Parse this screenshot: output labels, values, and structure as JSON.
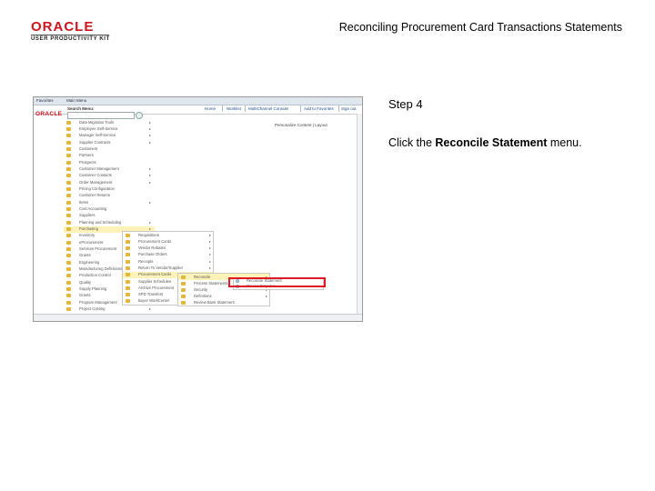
{
  "header": {
    "logo_text": "ORACLE",
    "logo_sub": "USER PRODUCTIVITY KIT",
    "doc_title": "Reconciling Procurement Card Transactions Statements"
  },
  "screenshot": {
    "topbar": {
      "favorites": "Favorites",
      "main_menu": "Main Menu"
    },
    "oracle_small": "ORACLE",
    "search_label": "Search Menu:",
    "links": [
      "Home",
      "Worklist",
      "MultiChannel Console",
      "Add to Favorites",
      "Sign out"
    ],
    "portal_text": "Personalize Content | Layout",
    "main_items": [
      "Data Migration Tools",
      "Employee Self-Service",
      "Manager Self-Service",
      "Supplier Contracts",
      "Customers",
      "Partners",
      "Prospects",
      "Customer Management",
      "Customer Contacts",
      "Order Management",
      "Pricing Configuration",
      "Customer Returns",
      "Items",
      "Cost Accounting",
      "Suppliers",
      "Planning and Scheduling",
      "Purchasing",
      "Inventory",
      "eProcurement",
      "Services Procurement",
      "Grants",
      "Engineering",
      "Manufacturing Definitions",
      "Production Control",
      "Quality",
      "Supply Planning",
      "Grants",
      "Program Management",
      "Project Costing"
    ],
    "sub1_items": [
      "Requisitions",
      "Procurement Cards",
      "Vendor Rebates",
      "Purchase Orders",
      "Receipts",
      "Return To Vendor/Supplier",
      "Procurement Cards",
      "Supplier Schedules",
      "Archive Procurement",
      "SPD Transfers",
      "Buyer WorkCenter"
    ],
    "sub2_items": [
      "Reconcile",
      "Process Statements",
      "Security",
      "Definitions",
      "Review Bank Statement"
    ],
    "sub3_items": [
      "Reconcile Statement",
      "Review Disputes"
    ]
  },
  "step": {
    "title": "Step 4",
    "text_before": "Click the ",
    "text_bold": "Reconcile Statement",
    "text_after": " menu."
  }
}
